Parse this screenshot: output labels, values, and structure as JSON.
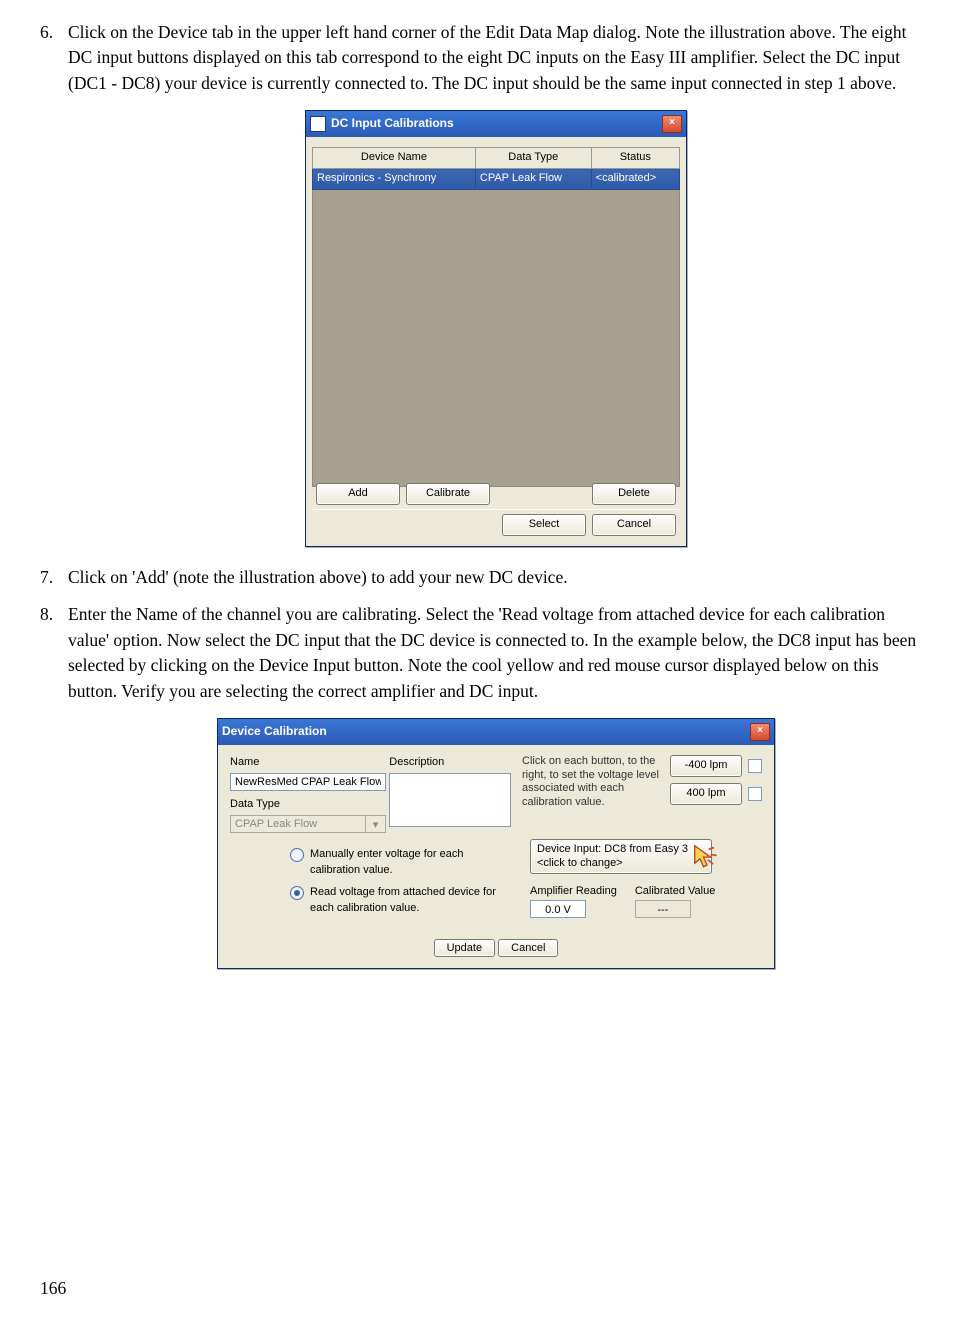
{
  "page_number": "166",
  "steps": {
    "s6": {
      "num": "6.",
      "text": "Click on the Device tab in the upper left hand corner of the Edit Data Map dialog.   Note the illustration above.  The eight DC input buttons displayed on this tab correspond to the eight DC inputs on the Easy III amplifier.  Select the DC input (DC1 - DC8) your device is currently connected to.  The DC input should be the same input connected in step 1 above."
    },
    "s7": {
      "num": "7.",
      "text": "Click on 'Add' (note the illustration above) to add your new DC device."
    },
    "s8": {
      "num": "8.",
      "text": "Enter the Name of the channel you are calibrating.  Select the 'Read voltage from attached device for each calibration value' option.  Now select the DC input that the DC device is connected to.  In the example below, the DC8 input has been selected by clicking on the Device Input button.  Note the cool yellow and red mouse cursor displayed below on this button.  Verify you are selecting the correct amplifier and DC input."
    }
  },
  "dialog1": {
    "title": "DC Input Calibrations",
    "headers": {
      "c1": "Device Name",
      "c2": "Data Type",
      "c3": "Status"
    },
    "row": {
      "c1": "Respironics - Synchrony",
      "c2": "CPAP Leak Flow",
      "c3": "<calibrated>"
    },
    "buttons": {
      "add": "Add",
      "calibrate": "Calibrate",
      "delete": "Delete",
      "select": "Select",
      "cancel": "Cancel"
    }
  },
  "dialog2": {
    "title": "Device Calibration",
    "labels": {
      "name": "Name",
      "description": "Description",
      "data_type": "Data Type",
      "amp_reading": "Amplifier Reading",
      "cal_value": "Calibrated Value"
    },
    "name_value": "NewResMed CPAP Leak Flow",
    "data_type_value": "CPAP Leak Flow",
    "instructions": "Click on each button, to the right, to set the voltage level associated with each calibration value.",
    "limits": {
      "low": "-400 lpm",
      "high": "400 lpm"
    },
    "radios": {
      "manual": "Manually enter voltage for each calibration value.",
      "read": "Read voltage from attached device for each calibration value."
    },
    "device_input_line1": "Device Input: DC8 from Easy 3",
    "device_input_line2": "<click to change>",
    "amp_reading_value": "0.0 V",
    "cal_value_value": "---",
    "buttons": {
      "update": "Update",
      "cancel": "Cancel"
    }
  }
}
